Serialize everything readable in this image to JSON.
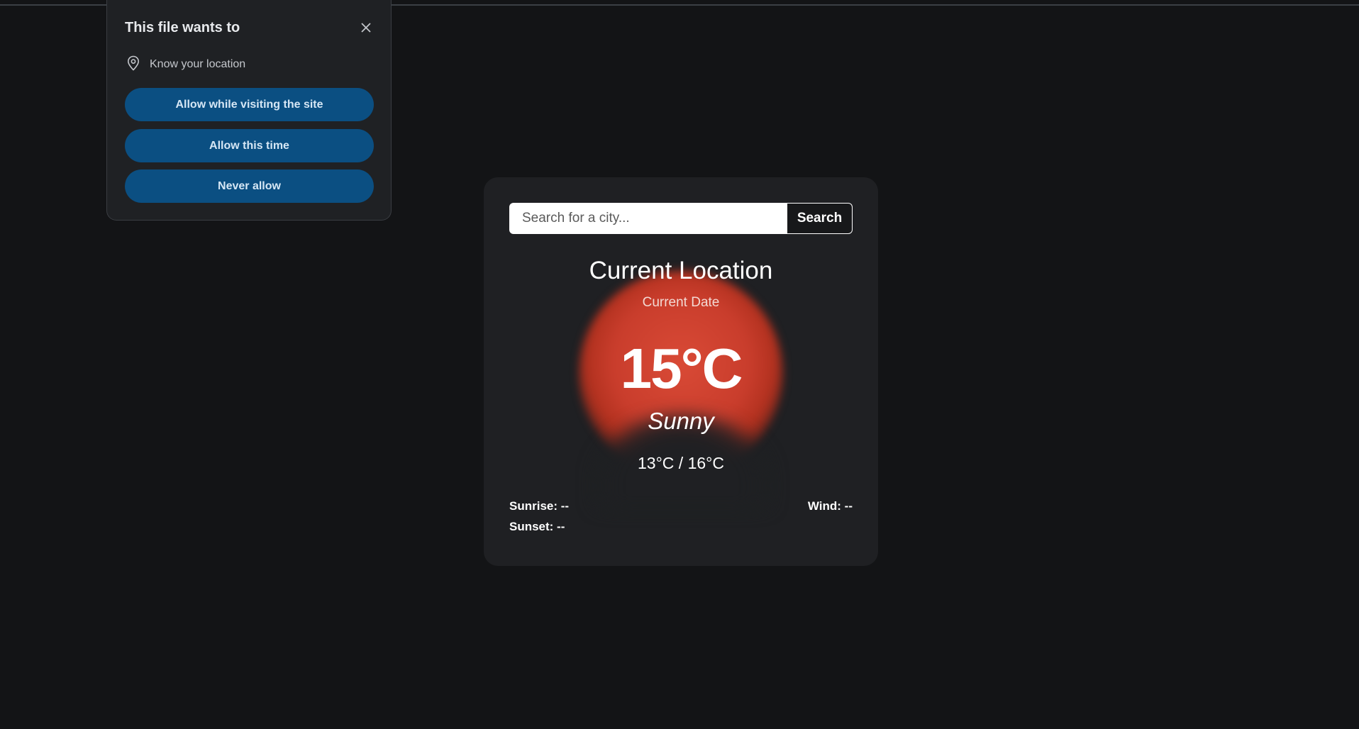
{
  "permission_popup": {
    "title": "This file wants to",
    "permission_label": "Know your location",
    "buttons": {
      "allow_while_visiting": "Allow while visiting the site",
      "allow_this_time": "Allow this time",
      "never_allow": "Never allow"
    },
    "icons": {
      "close": "close-icon",
      "location": "location-pin-icon"
    },
    "colors": {
      "button_background": "#0b4f82",
      "popup_background": "#1f2124"
    }
  },
  "weather": {
    "search": {
      "placeholder": "Search for a city...",
      "value": "",
      "button_label": "Search"
    },
    "location": "Current Location",
    "date": "Current Date",
    "temperature": "15°C",
    "condition": "Sunny",
    "min_max": "13°C / 16°C",
    "sunrise": "Sunrise: --",
    "sunset": "Sunset: --",
    "wind": "Wind: --",
    "colors": {
      "sun_glow": "#c93d2c",
      "card_background": "#1f2023",
      "page_background": "#131416"
    }
  }
}
